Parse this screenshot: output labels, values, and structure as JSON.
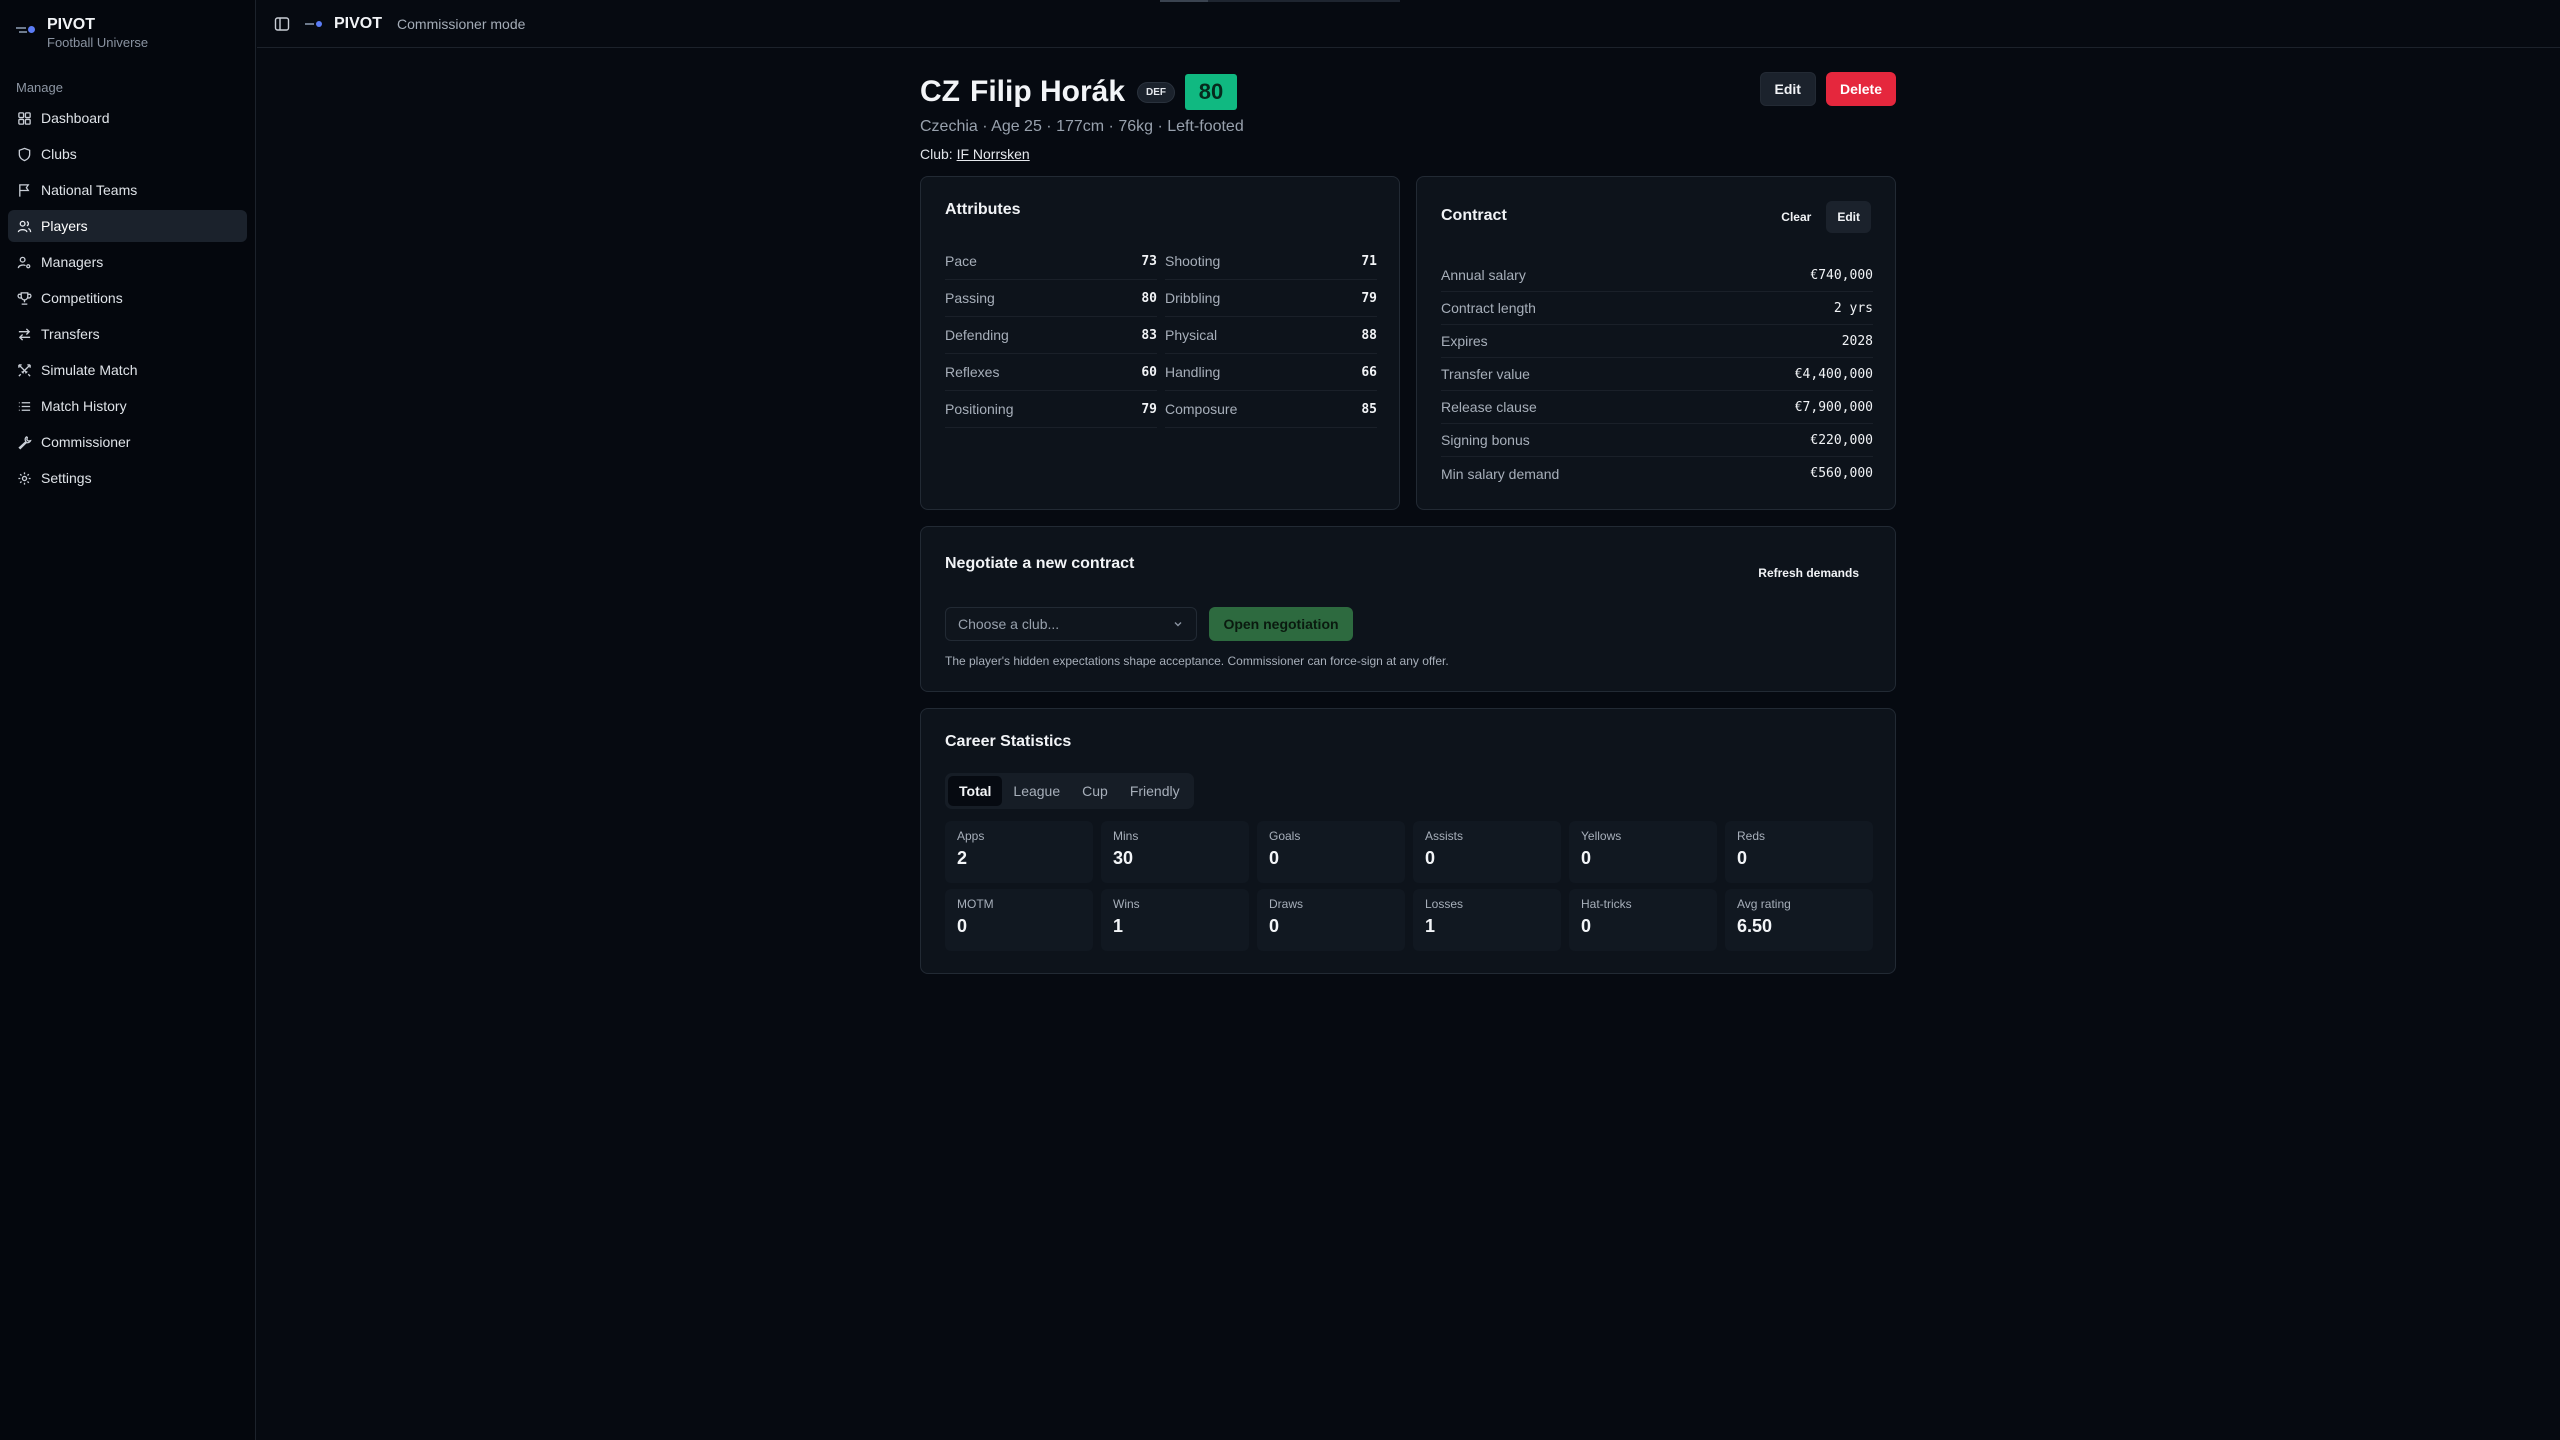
{
  "brand": {
    "title": "PIVOT",
    "subtitle": "Football Universe"
  },
  "sidebar": {
    "section": "Manage",
    "items": [
      {
        "label": "Dashboard",
        "icon": "grid-icon"
      },
      {
        "label": "Clubs",
        "icon": "shield-icon"
      },
      {
        "label": "National Teams",
        "icon": "flag-icon"
      },
      {
        "label": "Players",
        "icon": "users-icon",
        "active": true
      },
      {
        "label": "Managers",
        "icon": "user-cog-icon"
      },
      {
        "label": "Competitions",
        "icon": "trophy-icon"
      },
      {
        "label": "Transfers",
        "icon": "arrows-icon"
      },
      {
        "label": "Simulate Match",
        "icon": "swords-icon"
      },
      {
        "label": "Match History",
        "icon": "list-icon"
      },
      {
        "label": "Commissioner",
        "icon": "wrench-icon"
      },
      {
        "label": "Settings",
        "icon": "gear-icon"
      }
    ]
  },
  "topbar": {
    "app_name": "PIVOT",
    "mode": "Commissioner mode"
  },
  "player": {
    "flag": "CZ",
    "name": "Filip Horák",
    "position": "DEF",
    "overall": "80",
    "meta": "Czechia · Age 25 · 177cm · 76kg · Left-footed",
    "club_label": "Club:",
    "club_name": "IF Norrsken",
    "edit_label": "Edit",
    "delete_label": "Delete"
  },
  "attributes": {
    "title": "Attributes",
    "rows": [
      {
        "k": "Pace",
        "v": "73"
      },
      {
        "k": "Shooting",
        "v": "71"
      },
      {
        "k": "Passing",
        "v": "80"
      },
      {
        "k": "Dribbling",
        "v": "79"
      },
      {
        "k": "Defending",
        "v": "83"
      },
      {
        "k": "Physical",
        "v": "88"
      },
      {
        "k": "Reflexes",
        "v": "60"
      },
      {
        "k": "Handling",
        "v": "66"
      },
      {
        "k": "Positioning",
        "v": "79"
      },
      {
        "k": "Composure",
        "v": "85"
      }
    ]
  },
  "contract": {
    "title": "Contract",
    "clear_label": "Clear",
    "edit_label": "Edit",
    "rows": [
      {
        "k": "Annual salary",
        "v": "€740,000"
      },
      {
        "k": "Contract length",
        "v": "2 yrs"
      },
      {
        "k": "Expires",
        "v": "2028"
      },
      {
        "k": "Transfer value",
        "v": "€4,400,000"
      },
      {
        "k": "Release clause",
        "v": "€7,900,000"
      },
      {
        "k": "Signing bonus",
        "v": "€220,000"
      },
      {
        "k": "Min salary demand",
        "v": "€560,000"
      }
    ]
  },
  "negotiate": {
    "title": "Negotiate a new contract",
    "refresh_label": "Refresh demands",
    "select_placeholder": "Choose a club...",
    "open_label": "Open negotiation",
    "note": "The player's hidden expectations shape acceptance. Commissioner can force-sign at any offer."
  },
  "career": {
    "title": "Career Statistics",
    "tabs": [
      "Total",
      "League",
      "Cup",
      "Friendly"
    ],
    "active_tab": "Total",
    "stats": [
      {
        "label": "Apps",
        "value": "2"
      },
      {
        "label": "Mins",
        "value": "30"
      },
      {
        "label": "Goals",
        "value": "0"
      },
      {
        "label": "Assists",
        "value": "0"
      },
      {
        "label": "Yellows",
        "value": "0"
      },
      {
        "label": "Reds",
        "value": "0"
      },
      {
        "label": "MOTM",
        "value": "0"
      },
      {
        "label": "Wins",
        "value": "1"
      },
      {
        "label": "Draws",
        "value": "0"
      },
      {
        "label": "Losses",
        "value": "1"
      },
      {
        "label": "Hat-tricks",
        "value": "0"
      },
      {
        "label": "Avg rating",
        "value": "6.50"
      }
    ]
  }
}
